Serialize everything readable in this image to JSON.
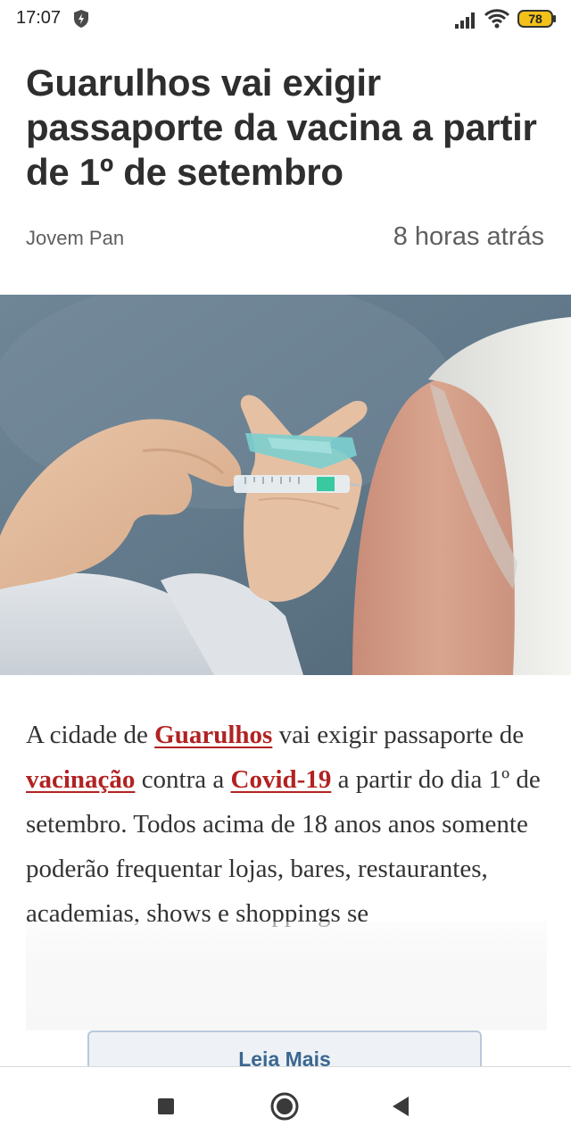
{
  "status_bar": {
    "time": "17:07",
    "battery_level": "78",
    "icons": [
      "shield-bolt-icon",
      "signal-icon",
      "wifi-icon",
      "battery-icon"
    ]
  },
  "article": {
    "headline": "Guarulhos vai exigir passaporte da vacina a partir de 1º de setembro",
    "source": "Jovem Pan",
    "time_ago": "8 horas atrás",
    "image": "vaccination-photo",
    "body": {
      "t1": "A cidade de ",
      "link1": "Guarulhos",
      "t2": " vai exigir passaporte de ",
      "link2": "vacinação",
      "t3": " contra a ",
      "link3": "Covid-19",
      "t4": " a partir do dia 1º de setembro. Todos acima de 18 anos anos somente poderão frequentar lojas, bares, restaurantes, academias, shows e shoppings se"
    },
    "read_more_label": "Leia Mais"
  },
  "colors": {
    "link": "#b22222",
    "read_more_text": "#3b6790",
    "read_more_border": "#b9c9d9"
  },
  "nav_bar": {
    "icons": [
      "recents-square-icon",
      "home-circle-icon",
      "back-triangle-icon"
    ]
  }
}
